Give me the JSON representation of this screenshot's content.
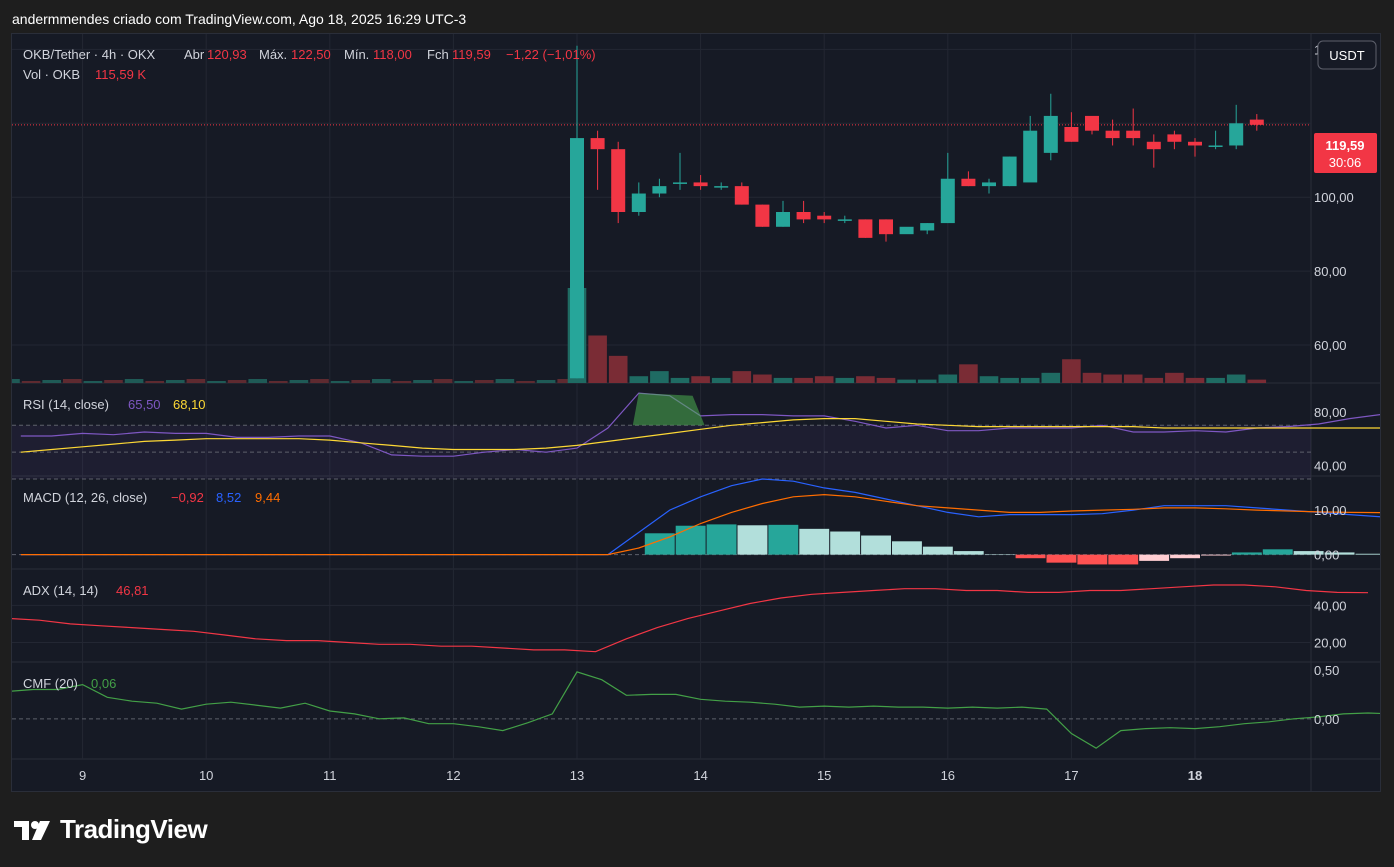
{
  "header": {
    "caption": "andermmendes criado com TradingView.com, Ago 18, 2025 16:29 UTC-3"
  },
  "legend": {
    "symbol": "OKB/Tether · 4h · OKX",
    "open_label": "Abr",
    "open": "120,93",
    "high_label": "Máx.",
    "high": "122,50",
    "low_label": "Mín.",
    "low": "118,00",
    "close_label": "Fch",
    "close": "119,59",
    "change": "−1,22 (−1,01%)",
    "vol_label": "Vol · OKB",
    "vol": "115,59 K"
  },
  "currency_button": "USDT",
  "last_price": {
    "value": "119,59",
    "countdown": "30:06"
  },
  "price_axis": {
    "labels": [
      "100,00",
      "80,00",
      "60,00"
    ],
    "top_partial": "140,00"
  },
  "rsi": {
    "label": "RSI (14, close)",
    "value1": "65,50",
    "value2": "68,10",
    "axis": [
      "80,00",
      "40,00"
    ]
  },
  "macd": {
    "label": "MACD (12, 26, close)",
    "v1": "−0,92",
    "v2": "8,52",
    "v3": "9,44",
    "axis": [
      "10,00",
      "0,00"
    ]
  },
  "adx": {
    "label": "ADX (14, 14)",
    "value": "46,81",
    "axis": [
      "40,00",
      "20,00"
    ]
  },
  "cmf": {
    "label": "CMF (20)",
    "value": "0,06",
    "axis": [
      "0,00"
    ],
    "top_partial": "0,50"
  },
  "time_axis": [
    "9",
    "10",
    "11",
    "12",
    "13",
    "14",
    "15",
    "16",
    "17",
    "18"
  ],
  "brand": "TradingView",
  "colors": {
    "up": "#26a69a",
    "down": "#f23645",
    "bg": "#161a25",
    "rsi": "#7e57c2",
    "rsi_ma": "#fdd835",
    "macd": "#2962ff",
    "signal": "#ff6d00",
    "adx": "#f23645",
    "cmf": "#43a047"
  },
  "chart_data": {
    "type": "candlestick",
    "title": "OKB/Tether · 4h · OKX",
    "x": [
      "13 00:00",
      "13 04:00",
      "13 08:00",
      "13 12:00",
      "13 16:00",
      "13 20:00",
      "14 00:00",
      "14 04:00",
      "14 08:00",
      "14 12:00",
      "14 16:00",
      "14 20:00",
      "15 00:00",
      "15 04:00",
      "15 08:00",
      "15 12:00",
      "15 16:00",
      "15 20:00",
      "16 00:00",
      "16 04:00",
      "16 08:00",
      "16 12:00",
      "16 16:00",
      "16 20:00",
      "17 00:00",
      "17 04:00",
      "17 08:00",
      "17 12:00",
      "17 16:00",
      "17 20:00",
      "18 00:00",
      "18 04:00",
      "18 08:00",
      "18 12:00"
    ],
    "open": [
      51,
      116,
      113,
      96,
      101,
      104,
      104,
      103,
      103,
      98,
      92,
      96,
      95,
      94,
      94,
      94,
      90,
      91,
      93,
      105,
      103,
      103,
      104,
      112,
      119,
      122,
      118,
      118,
      115,
      117,
      115,
      114,
      114,
      121
    ],
    "close": [
      116,
      113,
      96,
      101,
      103,
      104,
      103,
      103,
      98,
      92,
      96,
      94,
      94,
      94,
      89,
      90,
      92,
      93,
      105,
      103,
      104,
      111,
      118,
      122,
      115,
      118,
      116,
      116,
      113,
      115,
      114,
      114,
      120,
      119.59
    ],
    "high": [
      141,
      118,
      115,
      104,
      105,
      112,
      106,
      104,
      104,
      98,
      99,
      99,
      96,
      95,
      94,
      94,
      90,
      93,
      112,
      107,
      105,
      111,
      122,
      128,
      123,
      121,
      121,
      124,
      117,
      118,
      116,
      118,
      125,
      122.5
    ],
    "low": [
      51,
      102,
      93,
      95,
      100,
      102,
      102,
      102,
      98,
      92,
      92,
      93,
      93,
      93,
      89,
      88,
      90,
      90,
      94,
      103,
      101,
      103,
      113,
      110,
      115,
      117,
      114,
      114,
      108,
      113,
      111,
      113,
      113,
      118
    ],
    "volume_relative": [
      5.6,
      2.8,
      1.6,
      0.4,
      0.7,
      0.3,
      0.4,
      0.3,
      0.7,
      0.5,
      0.3,
      0.3,
      0.4,
      0.3,
      0.4,
      0.3,
      0.2,
      0.2,
      0.5,
      1.1,
      0.4,
      0.3,
      0.3,
      0.6,
      1.4,
      0.6,
      0.5,
      0.5,
      0.3,
      0.6,
      0.3,
      0.3,
      0.5,
      0.2
    ],
    "ylim": [
      50,
      142
    ],
    "volume_prior_bars": 45,
    "rsi": [
      62,
      62,
      64,
      63,
      65,
      64,
      64,
      61,
      61,
      62,
      62,
      57,
      48,
      47,
      47,
      50,
      52,
      50,
      53,
      68,
      94,
      92,
      77,
      78,
      78,
      77,
      77,
      73,
      68,
      70,
      66,
      66,
      68,
      68,
      68,
      70,
      65,
      65,
      66,
      65,
      68,
      69,
      71,
      75,
      78,
      70,
      70,
      69,
      66,
      66,
      68,
      66,
      66
    ],
    "rsi_ma": [
      50,
      52,
      54,
      56,
      58,
      59,
      60,
      60,
      60,
      60,
      59,
      57,
      55,
      53,
      52,
      52,
      52,
      53,
      55,
      58,
      61,
      64,
      67,
      70,
      72,
      74,
      75,
      75,
      73,
      71,
      70,
      69,
      69,
      69,
      69,
      69,
      69,
      68,
      68,
      68,
      68,
      68,
      68,
      68,
      68,
      68,
      68,
      68,
      68,
      68,
      68,
      68,
      68
    ],
    "rsi_ylim": [
      33,
      100
    ],
    "indicator_x_start": "8 12:00",
    "macd": [
      0,
      0,
      0,
      0,
      0,
      0,
      0,
      0,
      0,
      0,
      0,
      0,
      0,
      0,
      0,
      0,
      0,
      0,
      0,
      0,
      5.0,
      10.0,
      13.0,
      15.5,
      17.0,
      16.5,
      15.0,
      14.0,
      12.5,
      11.0,
      9.5,
      8.5,
      9.0,
      9.0,
      9.0,
      9.2,
      10.0,
      11.0,
      11.0,
      11.0,
      10.5,
      10.0,
      9.5,
      9.0,
      8.5
    ],
    "signal": [
      0,
      0,
      0,
      0,
      0,
      0,
      0,
      0,
      0,
      0,
      0,
      0,
      0,
      0,
      0,
      0,
      0,
      0,
      0,
      0,
      1.5,
      4.0,
      7.0,
      9.5,
      11.5,
      13.0,
      13.5,
      13.0,
      12.0,
      11.0,
      10.5,
      10.0,
      9.5,
      9.5,
      9.8,
      10.0,
      10.2,
      10.5,
      10.5,
      10.3,
      10.0,
      9.8,
      9.6,
      9.5,
      9.44
    ],
    "histogram": [
      0,
      0,
      0,
      0,
      0,
      0,
      0,
      0,
      0,
      0,
      0,
      0,
      0,
      0,
      0,
      0,
      0,
      0,
      0,
      0,
      4.8,
      6.5,
      6.8,
      6.6,
      6.7,
      5.8,
      5.2,
      4.3,
      3.0,
      1.8,
      0.8,
      0.1,
      -0.8,
      -1.8,
      -2.2,
      -2.2,
      -1.4,
      -0.8,
      -0.2,
      0.5,
      1.2,
      0.8,
      0.5,
      0.2,
      -0.5,
      -1.0,
      -1.2,
      -0.9
    ],
    "macd_ylim": [
      -3,
      17
    ],
    "adx": [
      33,
      32,
      30,
      29,
      28,
      27,
      26,
      24,
      22,
      21,
      21,
      20,
      19,
      19,
      18,
      18,
      17,
      16,
      16,
      15,
      22,
      28,
      33,
      37,
      41,
      44,
      46,
      47,
      48,
      49,
      49,
      48,
      48,
      47,
      47,
      48,
      48,
      49,
      50,
      51,
      51,
      50,
      48,
      47,
      46.81
    ],
    "adx_ylim": [
      10,
      58
    ],
    "cmf": [
      0.28,
      0.3,
      0.3,
      0.35,
      0.22,
      0.18,
      0.16,
      0.1,
      0.15,
      0.17,
      0.14,
      0.11,
      0.16,
      0.08,
      0.05,
      0.0,
      0.01,
      -0.05,
      -0.05,
      -0.08,
      -0.12,
      -0.04,
      0.05,
      0.48,
      0.4,
      0.24,
      0.25,
      0.25,
      0.2,
      0.18,
      0.17,
      0.15,
      0.12,
      0.13,
      0.12,
      0.13,
      0.12,
      0.12,
      0.11,
      0.12,
      0.11,
      0.12,
      0.1,
      -0.15,
      -0.3,
      -0.12,
      -0.1,
      -0.09,
      -0.1,
      -0.08,
      -0.05,
      -0.03,
      0.0,
      0.02,
      0.05,
      0.06,
      0.05,
      0.06
    ],
    "cmf_ylim": [
      -0.4,
      0.55
    ]
  }
}
